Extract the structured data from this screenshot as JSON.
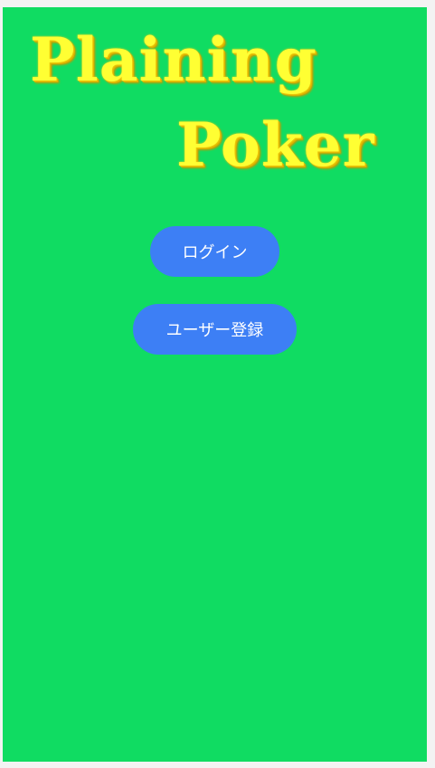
{
  "logo": {
    "line1": "Plaining",
    "line2": "Poker"
  },
  "buttons": {
    "login_label": "ログイン",
    "register_label": "ユーザー登録"
  },
  "colors": {
    "background": "#10dc62",
    "button": "#3d7ff5",
    "logo_text": "#ffff33"
  }
}
